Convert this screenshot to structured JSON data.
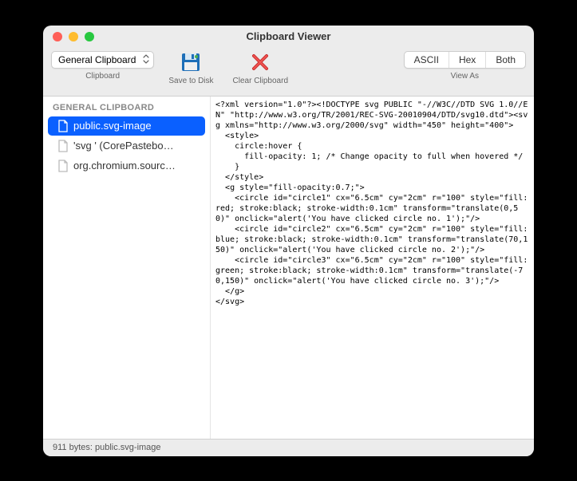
{
  "window": {
    "title": "Clipboard Viewer"
  },
  "toolbar": {
    "dropdown_value": "General Clipboard",
    "dropdown_group_label": "Clipboard",
    "save_label": "Save to Disk",
    "clear_label": "Clear Clipboard",
    "seg": {
      "ascii": "ASCII",
      "hex": "Hex",
      "both": "Both"
    },
    "view_as_label": "View As"
  },
  "sidebar": {
    "header": "GENERAL CLIPBOARD",
    "items": [
      {
        "label": "public.svg-image",
        "selected": true
      },
      {
        "label": "'svg ' (CorePastebo…",
        "selected": false
      },
      {
        "label": "org.chromium.sourc…",
        "selected": false
      }
    ]
  },
  "content": "<?xml version=\"1.0\"?><!DOCTYPE svg PUBLIC \"-//W3C//DTD SVG 1.0//EN\" \"http://www.w3.org/TR/2001/REC-SVG-20010904/DTD/svg10.dtd\"><svg xmlns=\"http://www.w3.org/2000/svg\" width=\"450\" height=\"400\">\n  <style>\n    circle:hover {\n      fill-opacity: 1; /* Change opacity to full when hovered */\n    }\n  </style>\n  <g style=\"fill-opacity:0.7;\">\n    <circle id=\"circle1\" cx=\"6.5cm\" cy=\"2cm\" r=\"100\" style=\"fill:red; stroke:black; stroke-width:0.1cm\" transform=\"translate(0,50)\" onclick=\"alert('You have clicked circle no. 1');\"/>\n    <circle id=\"circle2\" cx=\"6.5cm\" cy=\"2cm\" r=\"100\" style=\"fill:blue; stroke:black; stroke-width:0.1cm\" transform=\"translate(70,150)\" onclick=\"alert('You have clicked circle no. 2');\"/>\n    <circle id=\"circle3\" cx=\"6.5cm\" cy=\"2cm\" r=\"100\" style=\"fill:green; stroke:black; stroke-width:0.1cm\" transform=\"translate(-70,150)\" onclick=\"alert('You have clicked circle no. 3');\"/>\n  </g>\n</svg>",
  "statusbar": {
    "text": "911 bytes: public.svg-image"
  }
}
